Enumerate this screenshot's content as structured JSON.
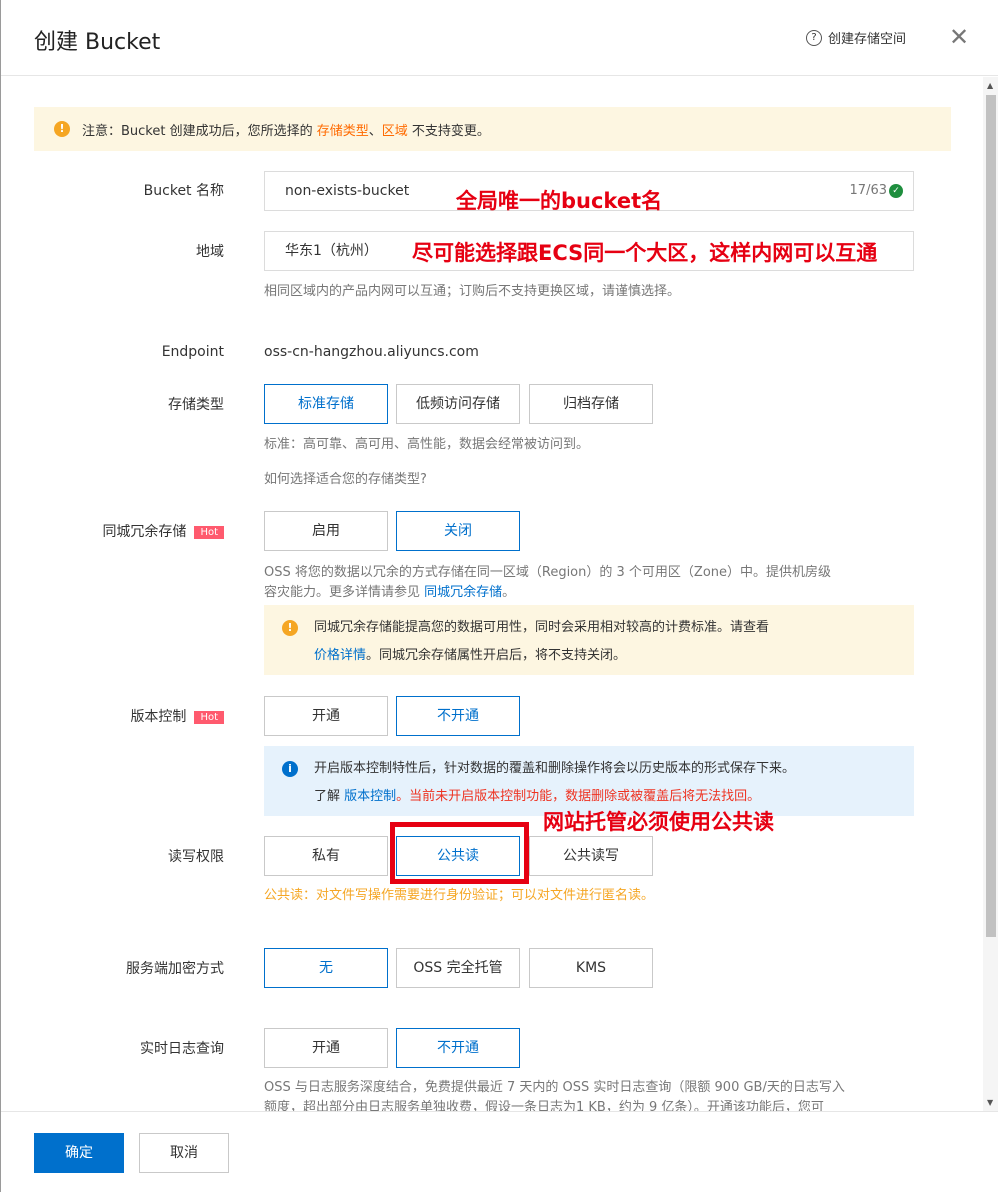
{
  "dialog": {
    "title": "创建 Bucket",
    "help_icon": "question-circle-icon",
    "help_label": "创建存储空间",
    "close_icon": "close-icon"
  },
  "notice": {
    "prefix": "注意：Bucket 创建成功后，您所选择的 ",
    "storage_type": "存储类型",
    "sep": "、",
    "region": "区域",
    "suffix": " 不支持变更。"
  },
  "fields": {
    "bucket_name": {
      "label": "Bucket 名称",
      "value": "non-exists-bucket",
      "counter": "17/63"
    },
    "region": {
      "label": "地域",
      "value": "华东1（杭州）",
      "tip": "相同区域内的产品内网可以互通；订购后不支持更换区域，请谨慎选择。"
    },
    "endpoint": {
      "label": "Endpoint",
      "value": "oss-cn-hangzhou.aliyuncs.com"
    },
    "storage_class": {
      "label": "存储类型",
      "options": [
        "标准存储",
        "低频访问存储",
        "归档存储"
      ],
      "selected": "标准存储",
      "tip": "标准：高可靠、高可用、高性能，数据会经常被访问到。",
      "link": "如何选择适合您的存储类型?"
    },
    "zrs": {
      "label": "同城冗余存储",
      "hot": "Hot",
      "options": [
        "启用",
        "关闭"
      ],
      "selected": "关闭",
      "tip_line1": "OSS 将您的数据以冗余的方式存储在同一区域（Region）的 3 个可用区（Zone）中。提供机房级",
      "tip_line2": "容灾能力。更多详情请参见 ",
      "tip_link": "同城冗余存储",
      "tip_end": "。",
      "warn_line1": "同城冗余存储能提高您的数据可用性，同时会采用相对较高的计费标准。请查看",
      "warn_link": "价格详情",
      "warn_line2": "。同城冗余存储属性开启后，将不支持关闭。"
    },
    "versioning": {
      "label": "版本控制",
      "hot": "Hot",
      "options": [
        "开通",
        "不开通"
      ],
      "selected": "不开通",
      "info_line1": "开启版本控制特性后，针对数据的覆盖和删除操作将会以历史版本的形式保存下来。",
      "info_pre": "了解 ",
      "info_link": "版本控制",
      "info_red": "。当前未开启版本控制功能，数据删除或被覆盖后将无法找回。"
    },
    "acl": {
      "label": "读写权限",
      "options": [
        "私有",
        "公共读",
        "公共读写"
      ],
      "selected": "公共读",
      "tip": "公共读：对文件写操作需要进行身份验证；可以对文件进行匿名读。"
    },
    "encryption": {
      "label": "服务端加密方式",
      "options": [
        "无",
        "OSS 完全托管",
        "KMS"
      ],
      "selected": "无"
    },
    "realtime_log": {
      "label": "实时日志查询",
      "options": [
        "开通",
        "不开通"
      ],
      "selected": "不开通",
      "tip_line1": "OSS 与日志服务深度结合，免费提供最近 7 天内的 OSS 实时日志查询（限额 900 GB/天的日志写入",
      "tip_line2": "额度，超出部分由日志服务单独收费，假设一条日志为1 KB，约为 9 亿条）。开通该功能后，您可"
    }
  },
  "annotations": {
    "bucket_name": "全局唯一的bucket名",
    "region": "尽可能选择跟ECS同一个大区，这样内网可以互通",
    "acl": "网站托管必须使用公共读"
  },
  "footer": {
    "confirm": "确定",
    "cancel": "取消"
  },
  "colors": {
    "primary": "#0070cc",
    "warning_bg": "#fdf6e1",
    "info_bg": "#e6f2fc",
    "annotation": "#e60012",
    "hot": "#ff5a6e"
  }
}
